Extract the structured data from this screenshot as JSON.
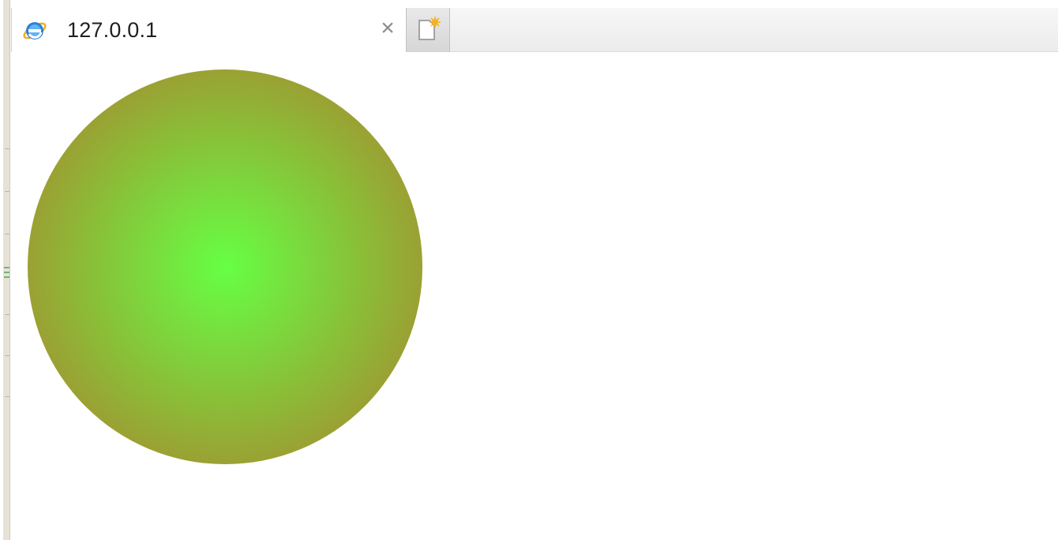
{
  "browser": {
    "tab": {
      "title": "127.0.0.1",
      "icon": "internet-explorer-icon",
      "close_glyph": "×"
    },
    "new_tab_icon": "new-tab-icon"
  },
  "page": {
    "shape": "circle",
    "gradient": {
      "type": "radial",
      "center_color": "#66ff44",
      "edge_color": "#b07a2c"
    }
  }
}
